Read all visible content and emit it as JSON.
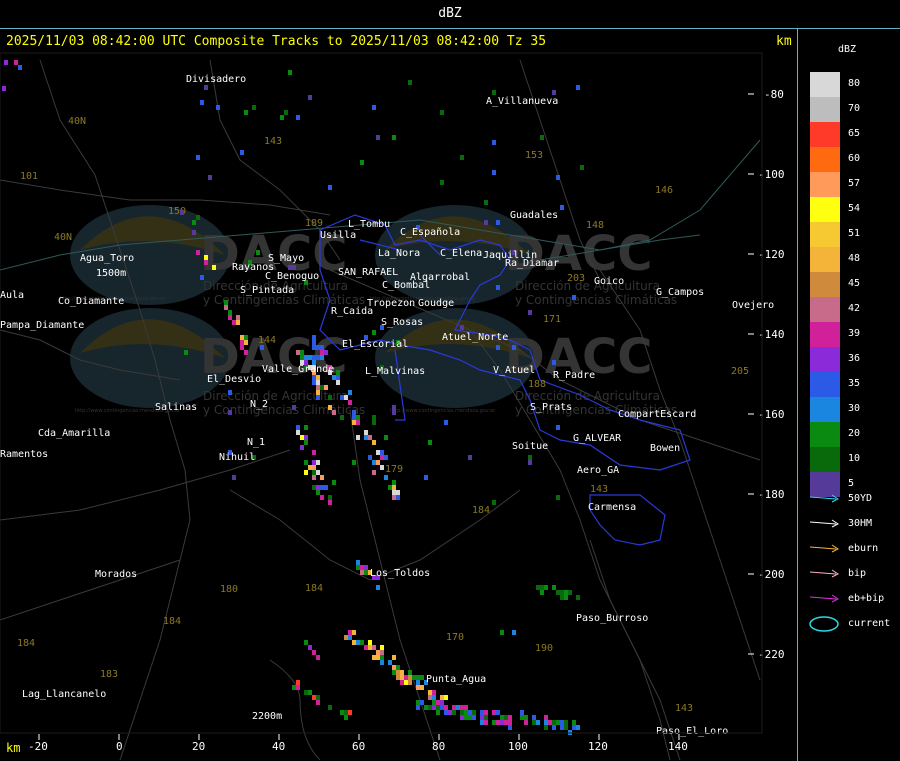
{
  "window": {
    "title": "dBZ"
  },
  "header": {
    "text": "2025/11/03 08:42:00 UTC Composite Tracks to 2025/11/03 08:42:00 Tz 35",
    "km_label_top": "km",
    "km_label_bottom": "km"
  },
  "axes": {
    "x_ticks": [
      "-20",
      "0",
      "20",
      "40",
      "60",
      "80",
      "100",
      "120",
      "140"
    ],
    "y_ticks": [
      "-80",
      "-100",
      "-120",
      "-140",
      "-160",
      "-180",
      "-200",
      "-220"
    ]
  },
  "legend": {
    "title": "dBZ",
    "entries": [
      {
        "label": "80",
        "color": "#d8d8d8"
      },
      {
        "label": "70",
        "color": "#bdbdbd"
      },
      {
        "label": "65",
        "color": "#ff3a28"
      },
      {
        "label": "60",
        "color": "#ff6a10"
      },
      {
        "label": "57",
        "color": "#ff9a5a"
      },
      {
        "label": "54",
        "color": "#ffff10"
      },
      {
        "label": "51",
        "color": "#f6c832"
      },
      {
        "label": "48",
        "color": "#f4b43a"
      },
      {
        "label": "45",
        "color": "#d08a3c"
      },
      {
        "label": "42",
        "color": "#c86a8a"
      },
      {
        "label": "39",
        "color": "#d0209a"
      },
      {
        "label": "36",
        "color": "#8a2ad8"
      },
      {
        "label": "35",
        "color": "#2a5ae6"
      },
      {
        "label": "30",
        "color": "#1a86e0"
      },
      {
        "label": "20",
        "color": "#0a8a10"
      },
      {
        "label": "10",
        "color": "#086a0a"
      },
      {
        "label": "5",
        "color": "#553a9a"
      }
    ],
    "tracks": [
      {
        "label": "50YD",
        "color": "#2ad8e8",
        "kind": "arrow"
      },
      {
        "label": "30HM",
        "color": "#ffffff",
        "kind": "arrow"
      },
      {
        "label": "eburn",
        "color": "#f4b43a",
        "kind": "arrow"
      },
      {
        "label": "bip",
        "color": "#ffb0c8",
        "kind": "arrow"
      },
      {
        "label": "eb+bip",
        "color": "#e030e0",
        "kind": "arrow"
      },
      {
        "label": "current",
        "color": "#2ad8e8",
        "kind": "ellipse"
      }
    ]
  },
  "map": {
    "towns": [
      {
        "name": "Divisadero"
      },
      {
        "name": "A_Villanueva"
      },
      {
        "name": "Guadales"
      },
      {
        "name": "Usilla"
      },
      {
        "name": "L_Tombu"
      },
      {
        "name": "C_Española"
      },
      {
        "name": "La_Nora"
      },
      {
        "name": "C_Elena"
      },
      {
        "name": "Jaquillin"
      },
      {
        "name": "Ra_Diamar"
      },
      {
        "name": "Goico"
      },
      {
        "name": "G_Campos"
      },
      {
        "name": "Ovejero"
      },
      {
        "name": "Agua_Toro"
      },
      {
        "name": "1500m"
      },
      {
        "name": "Rayanos"
      },
      {
        "name": "S_Mayo"
      },
      {
        "name": "C_Benoguo"
      },
      {
        "name": "SAN_RAFAEL"
      },
      {
        "name": "Algarrobal"
      },
      {
        "name": "C_Bombal"
      },
      {
        "name": "Tropezon"
      },
      {
        "name": "Goudge"
      },
      {
        "name": "S_Pintada"
      },
      {
        "name": "R_Caida"
      },
      {
        "name": "S_Rosas"
      },
      {
        "name": "Atuel_Norte"
      },
      {
        "name": "El_Escorial"
      },
      {
        "name": "Pampa_Diamante"
      },
      {
        "name": "Co_Diamante"
      },
      {
        "name": "El_Desvio"
      },
      {
        "name": "Valle_Grande"
      },
      {
        "name": "L_Malvinas"
      },
      {
        "name": "V_Atuel"
      },
      {
        "name": "R_Padre"
      },
      {
        "name": "Salinas"
      },
      {
        "name": "N_2"
      },
      {
        "name": "N_1"
      },
      {
        "name": "Nihuil"
      },
      {
        "name": "S_Prats"
      },
      {
        "name": "CompartEscard"
      },
      {
        "name": "G_ALVEAR"
      },
      {
        "name": "Soitue"
      },
      {
        "name": "Bowen"
      },
      {
        "name": "Aero_GA"
      },
      {
        "name": "Carmensa"
      },
      {
        "name": "Cda_Amarilla"
      },
      {
        "name": "Ramentos"
      },
      {
        "name": "Los_Toldos"
      },
      {
        "name": "Morados"
      },
      {
        "name": "Paso_Burroso"
      },
      {
        "name": "Punta_Agua"
      },
      {
        "name": "Lag_Llancanelo"
      },
      {
        "name": "2200m"
      },
      {
        "name": "Paso_El_Loro"
      },
      {
        "name": "Aula"
      },
      {
        "name": "40N"
      }
    ],
    "route_numbers": [
      "101",
      "143",
      "153",
      "146",
      "148",
      "150",
      "144",
      "203",
      "171",
      "189",
      "188",
      "143",
      "179",
      "184",
      "184",
      "170",
      "190",
      "180",
      "184",
      "183",
      "143",
      "205",
      "184",
      "40N"
    ],
    "watermark": {
      "logo": "DACC",
      "line1": "Dirección de Agricultura",
      "line2": "y Contingencias Climáticas",
      "url": "http://www.contingencias.mendoza.gov.ar"
    }
  }
}
